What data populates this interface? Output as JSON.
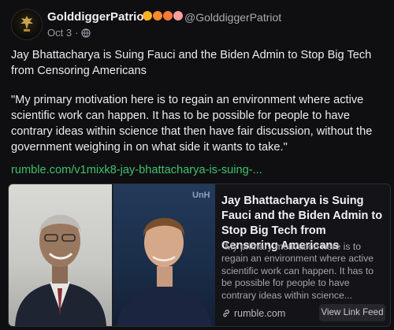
{
  "author": {
    "display_name": "GolddiggerPatriot",
    "handle": "@GolddiggerPatriot",
    "badge_colors": [
      "#ffb020",
      "#ff8a2a",
      "#ff7a3a",
      "#ff9e9e"
    ],
    "date": "Oct 3",
    "separator": "·",
    "visibility_icon": "globe-icon"
  },
  "post": {
    "headline": "Jay Bhattacharya is Suing Fauci and the Biden Admin to Stop Big Tech from Censoring Americans",
    "quote": "\"My primary motivation here is to regain an environment where active scientific work can happen. It has to be possible for people to have contrary ideas within science that then have fair discussion, without the government weighing in on what side it wants to take.\"",
    "link_text": "rumble.com/v1mixk8-jay-bhattacharya-is-suing-...",
    "link_color": "#3fc06a"
  },
  "card": {
    "watermark": "UnH",
    "title": "Jay Bhattacharya is Suing Fauci and the Biden Admin to Stop Big Tech from Censoring Americans",
    "description": "\"My primary motivation here is to regain an environment where active scientific work can happen. It has to be possible for people to have contrary ideas within science...",
    "domain": "rumble.com",
    "button_label": "View Link Feed"
  }
}
